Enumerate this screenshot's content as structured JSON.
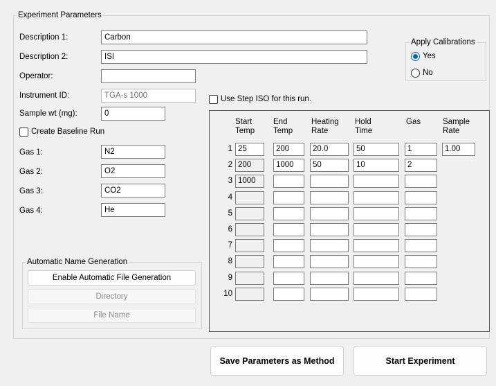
{
  "experiment_group": {
    "title": "Experiment Parameters",
    "description1_label": "Description 1:",
    "description1_value": "Carbon",
    "description2_label": "Description 2:",
    "description2_value": "ISI",
    "operator_label": "Operator:",
    "operator_value": "",
    "instrument_label": "Instrument ID:",
    "instrument_value": "TGA-s 1000",
    "sample_wt_label": "Sample wt (mg):",
    "sample_wt_value": "0",
    "create_baseline_label": "Create Baseline Run",
    "gas1_label": "Gas 1:",
    "gas1_value": "N2",
    "gas2_label": "Gas 2:",
    "gas2_value": "O2",
    "gas3_label": "Gas 3:",
    "gas3_value": "CO2",
    "gas4_label": "Gas 4:",
    "gas4_value": "He",
    "use_step_iso_label": "Use Step ISO for this run."
  },
  "calibrations": {
    "title": "Apply Calibrations",
    "yes_label": "Yes",
    "no_label": "No",
    "selected": "Yes"
  },
  "steps_table": {
    "headers": [
      "Start\nTemp",
      "End\nTemp",
      "Heating\nRate",
      "Hold\nTime",
      "Gas",
      "Sample\nRate"
    ],
    "rows": [
      {
        "num": "1",
        "start": "25",
        "end": "200",
        "rate": "20.0",
        "hold": "50",
        "gas": "1"
      },
      {
        "num": "2",
        "start": "200",
        "end": "1000",
        "rate": "50",
        "hold": "10",
        "gas": "2"
      },
      {
        "num": "3",
        "start": "1000",
        "end": "",
        "rate": "",
        "hold": "",
        "gas": ""
      },
      {
        "num": "4",
        "start": "",
        "end": "",
        "rate": "",
        "hold": "",
        "gas": ""
      },
      {
        "num": "5",
        "start": "",
        "end": "",
        "rate": "",
        "hold": "",
        "gas": ""
      },
      {
        "num": "6",
        "start": "",
        "end": "",
        "rate": "",
        "hold": "",
        "gas": ""
      },
      {
        "num": "7",
        "start": "",
        "end": "",
        "rate": "",
        "hold": "",
        "gas": ""
      },
      {
        "num": "8",
        "start": "",
        "end": "",
        "rate": "",
        "hold": "",
        "gas": ""
      },
      {
        "num": "9",
        "start": "",
        "end": "",
        "rate": "",
        "hold": "",
        "gas": ""
      },
      {
        "num": "10",
        "start": "",
        "end": "",
        "rate": "",
        "hold": "",
        "gas": ""
      }
    ],
    "sample_rate_value": "1.00"
  },
  "auto_name": {
    "title": "Automatic Name Generation",
    "enable_label": "Enable Automatic File Generation",
    "directory_label": "Directory",
    "filename_label": "File Name"
  },
  "actions": {
    "save_method_label": "Save Parameters as Method",
    "start_label": "Start Experiment"
  }
}
